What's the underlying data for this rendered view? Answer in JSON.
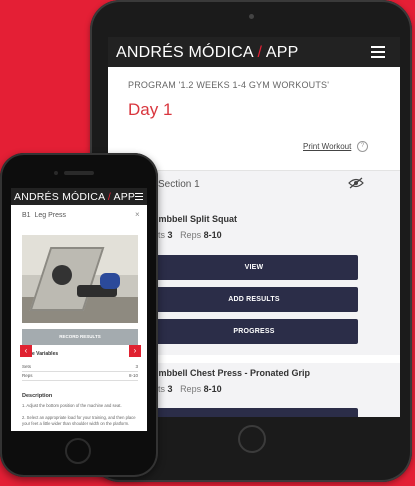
{
  "brand": {
    "part1": "ANDRÉS MÓDICA ",
    "slash": "/",
    "part2": " APP"
  },
  "tablet": {
    "program": "PROGRAM '1.2 WEEKS 1-4 GYM WORKOUTS'",
    "day": "Day 1",
    "print": "Print Workout",
    "section": "Section 1",
    "exercise1": {
      "name": "umbbell Split Squat",
      "sets_label": "ets",
      "sets": "3",
      "reps_label": "Reps",
      "reps": "8-10"
    },
    "buttons": {
      "view": "VIEW",
      "add_results": "ADD RESULTS",
      "progress": "PROGRESS"
    },
    "exercise2": {
      "name": "umbbell Chest Press - Pronated Grip",
      "sets_label": "ets",
      "sets": "3",
      "reps_label": "Reps",
      "reps": "8-10"
    }
  },
  "phone": {
    "exercise_code": "B1",
    "exercise_name": "Leg Press",
    "record_results": "RECORD RESULTS",
    "exercise_variables": "e Variables",
    "variables": [
      {
        "name": "Sets",
        "value": "3"
      },
      {
        "name": "Reps",
        "value": "8-10"
      }
    ],
    "description_title": "Description",
    "steps": [
      "1. Adjust the bottom position of the machine and seat.",
      "2. Select an appropriate load for your training, and then place your feet a little wider than shoulder width on the platform."
    ]
  },
  "colors": {
    "background": "#e41f35",
    "accent": "#d9363e",
    "button": "#2b2d48"
  }
}
